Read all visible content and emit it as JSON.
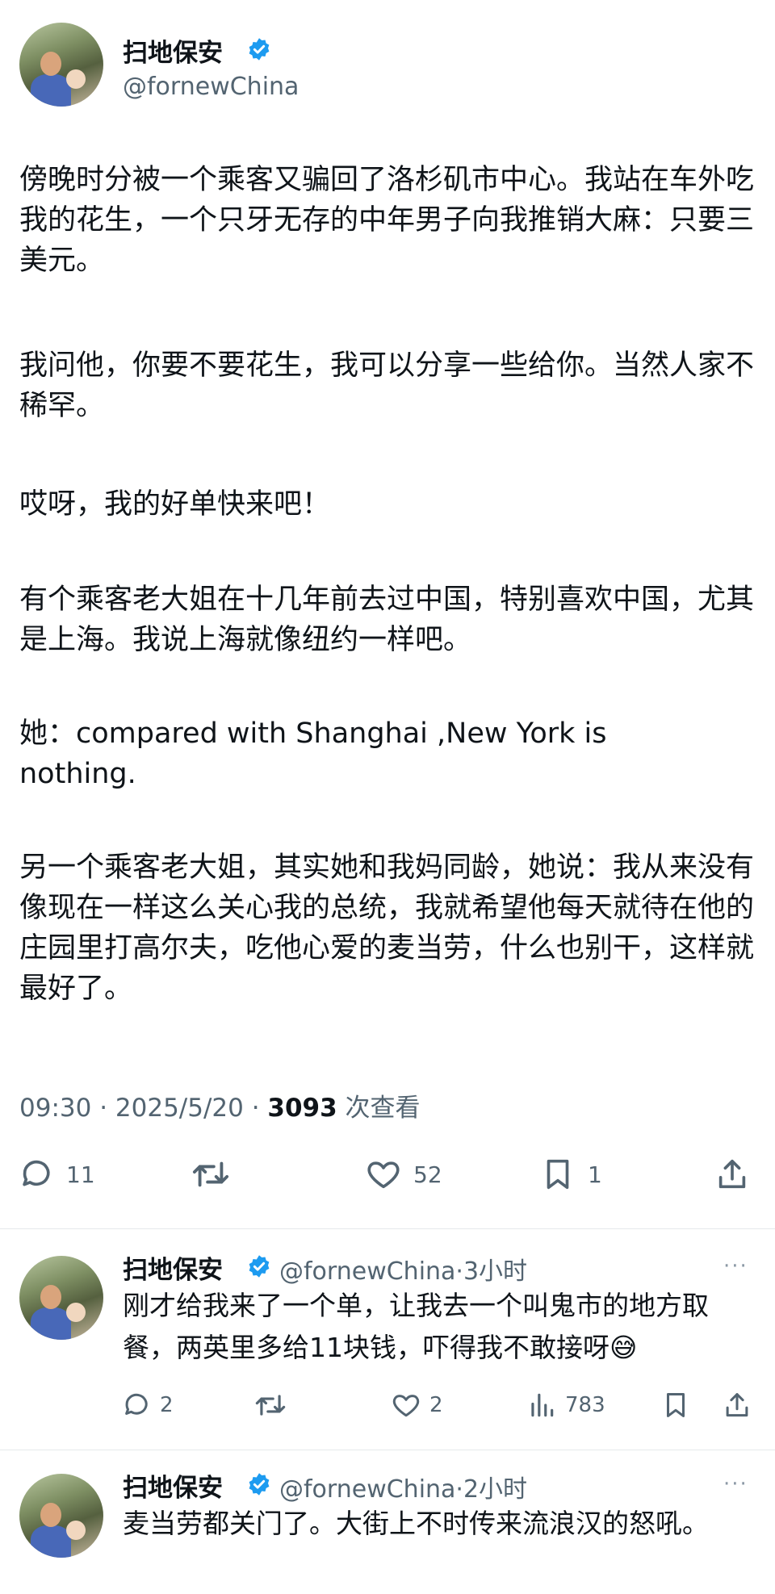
{
  "author": {
    "name": "扫地保安",
    "handle": "@fornewChina"
  },
  "post": {
    "paragraphs": [
      "傍晚时分被一个乘客又骗回了洛杉矶市中心。我站在车外吃我的花生，一个只牙无存的中年男子向我推销大麻：只要三美元。",
      "我问他，你要不要花生，我可以分享一些给你。当然人家不稀罕。",
      "哎呀，我的好单快来吧！",
      "有个乘客老大姐在十几年前去过中国，特别喜欢中国，尤其是上海。我说上海就像纽约一样吧。",
      "她：compared with Shanghai ,New York is nothing.",
      "另一个乘客老大姐，其实她和我妈同龄，她说：我从来没有像现在一样这么关心我的总统，我就希望他每天就待在他的庄园里打高尔夫，吃他心爱的麦当劳，什么也别干，这样就最好了。"
    ],
    "meta_time": "09:30 · 2025/5/20 · ",
    "views_count": "3093",
    "views_label": " 次查看",
    "actions": {
      "replies": "11",
      "likes": "52",
      "bookmarks": "1"
    }
  },
  "replies": [
    {
      "name": "扫地保安",
      "handle_time": "@fornewChina·3小时",
      "text": "刚才给我来了一个单，让我去一个叫鬼市的地方取餐，两英里多给11块钱，吓得我不敢接呀😅",
      "reply_count": "2",
      "like_count": "2",
      "view_count": "783"
    },
    {
      "name": "扫地保安",
      "handle_time": "@fornewChina·2小时",
      "text": "麦当劳都关门了。大街上不时传来流浪汉的怒吼。"
    }
  ],
  "more_label": "···",
  "colors": {
    "verified": "#1d9bf0",
    "text": "#0f1419",
    "secondary": "#536471"
  }
}
